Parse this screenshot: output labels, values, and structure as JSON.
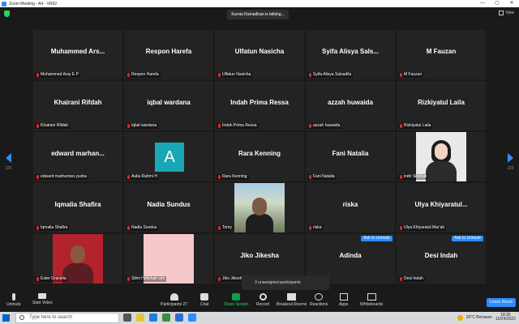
{
  "window": {
    "title": "Zoom Meeting - A4 - VR62",
    "minimize": "—",
    "restore": "▢",
    "close": "✕"
  },
  "topbar": {
    "talking": "Kurnia Ramadhan is talking...",
    "view_label": "View"
  },
  "tiles": [
    {
      "name": "Muhammed Ars...",
      "label": "Muhammed Arsy E P",
      "type": "name"
    },
    {
      "name": "Respon Harefa",
      "label": "Respon Harefa",
      "type": "name"
    },
    {
      "name": "Ulfatun Nasicha",
      "label": "Ulfatun Nasicha",
      "type": "name"
    },
    {
      "name": "Syifa Alisya Sals...",
      "label": "Syifa Alisya Salsadila",
      "type": "name"
    },
    {
      "name": "M Fauzan",
      "label": "M Fauzan",
      "type": "name"
    },
    {
      "name": "Khairani Rifdah",
      "label": "Khairani Rifdah",
      "type": "name"
    },
    {
      "name": "iqbal wardana",
      "label": "iqbal wardana",
      "type": "name"
    },
    {
      "name": "Indah Prima Ressa",
      "label": "Indah Prima Ressa",
      "type": "name"
    },
    {
      "name": "azzah huwaida",
      "label": "azzah huwaida",
      "type": "name"
    },
    {
      "name": "Rizkiyatul Laila",
      "label": "Rizkiyatul Laila",
      "type": "name"
    },
    {
      "name": "edward marhan...",
      "label": "edward marhannes purba",
      "type": "name"
    },
    {
      "name": "",
      "label": "Aulia Rahmi H",
      "type": "avatar",
      "initial": "A",
      "avatar_color": "#1aa7b5"
    },
    {
      "name": "Rara Kenning",
      "label": "Rara Kenning",
      "type": "name"
    },
    {
      "name": "Fani Natalia",
      "label": "Fani Natalia",
      "type": "name"
    },
    {
      "name": "",
      "label": "indri Sillehati",
      "type": "photo1"
    },
    {
      "name": "Iqmalia Shafira",
      "label": "Iqmalia Shafira",
      "type": "name"
    },
    {
      "name": "Nadia Sundus",
      "label": "Nadia Sundus",
      "type": "name"
    },
    {
      "name": "",
      "label": "Tomy",
      "type": "photo2"
    },
    {
      "name": "riska",
      "label": "riska",
      "type": "name"
    },
    {
      "name": "Ulya Khiyaratul...",
      "label": "Ulya Khiyaratul Mar'ah",
      "type": "name"
    },
    {
      "name": "",
      "label": "Ester Graciela",
      "type": "photo3"
    },
    {
      "name": "",
      "label": "Silmi Hafizhah Um",
      "type": "photo4"
    },
    {
      "name": "Jiko Jikesha",
      "label": "Jiko Jikesha",
      "type": "name"
    },
    {
      "name": "Adinda",
      "label": "",
      "type": "name",
      "unmute": "Ask to Unmute"
    },
    {
      "name": "Desi Indah",
      "label": "Desi Indah",
      "type": "name",
      "unmute": "Ask to Unmute"
    }
  ],
  "pager": {
    "left": "2/3",
    "right": "2/3"
  },
  "unassigned": "3 unassigned participants",
  "toolbar": {
    "unmute": "Unmute",
    "start_video": "Start Video",
    "participants": "Participants",
    "participants_count": "27",
    "chat": "Chat",
    "share_screen": "Share Screen",
    "record": "Record",
    "breakout_rooms": "Breakout Rooms",
    "reactions": "Reactions",
    "apps": "Apps",
    "whiteboards": "Whiteboards",
    "leave_room": "Leave Room"
  },
  "taskbar": {
    "search_placeholder": "Type here to search",
    "weather": "26°C Berawan",
    "time": "18:35",
    "date": "10/24/2022"
  }
}
